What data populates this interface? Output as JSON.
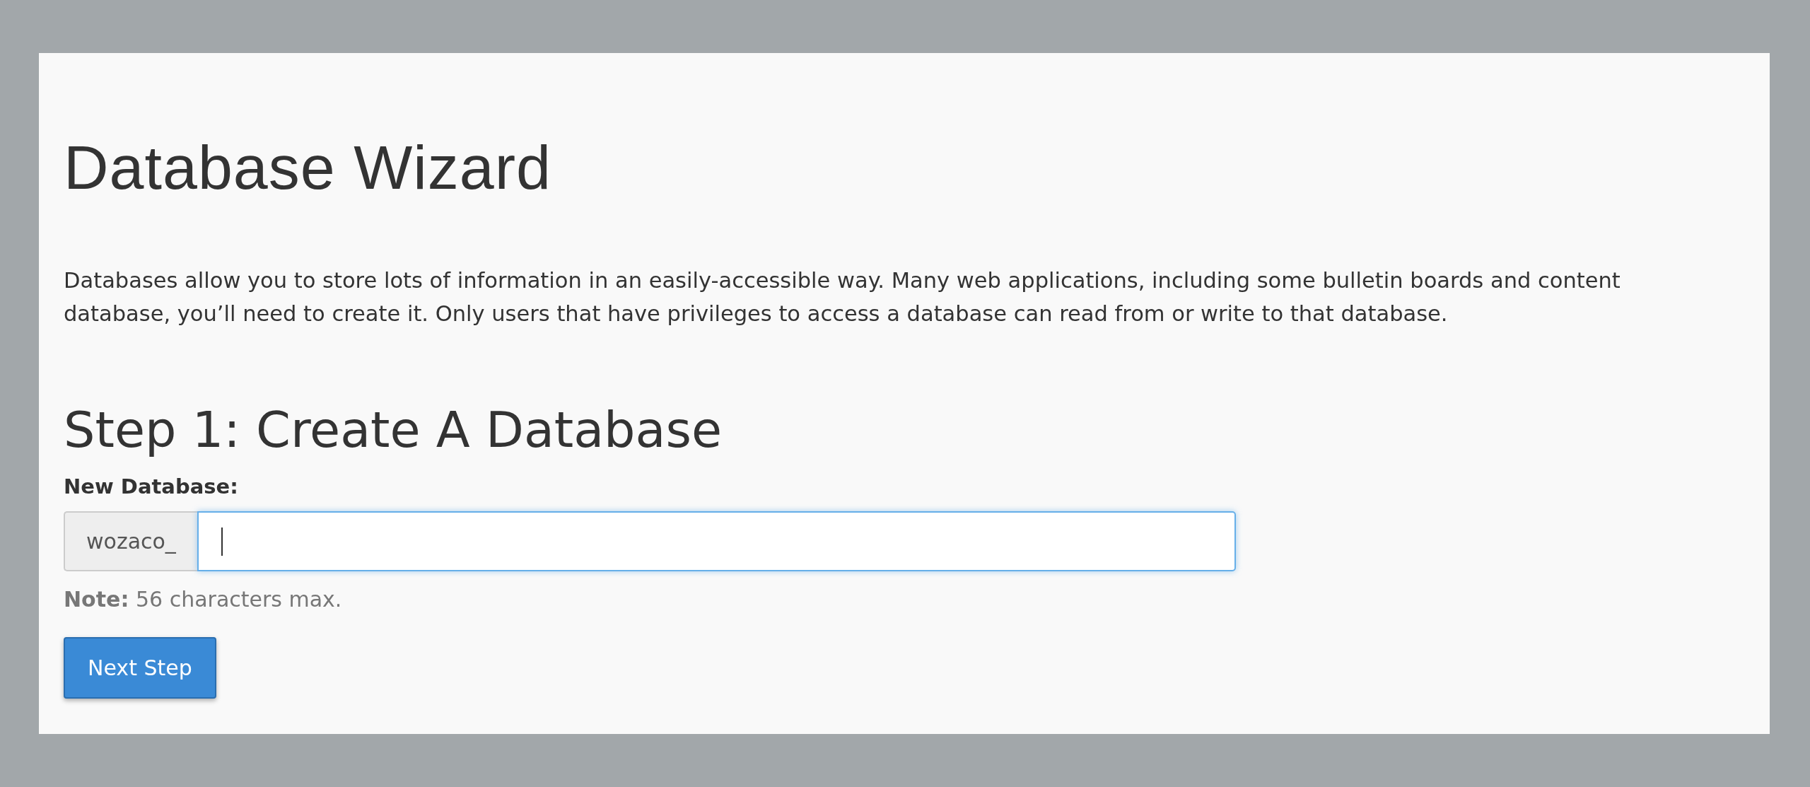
{
  "title": "Database Wizard",
  "intro_lines": [
    "Databases allow you to store lots of information in an easily-accessible way. Many web applications, including some bulletin boards and content",
    "database, you’ll need to create it. Only users that have privileges to access a database can read from or write to that database."
  ],
  "step_heading": "Step 1: Create A Database",
  "field": {
    "label": "New Database:",
    "prefix": "wozaco_",
    "focused": true
  },
  "note": "**Note:** 56 characters max.",
  "button": "Next Step"
}
